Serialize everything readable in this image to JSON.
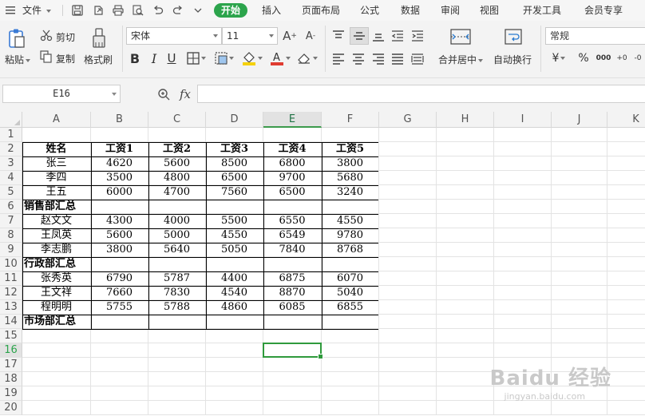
{
  "menubar": {
    "file_label": "文件",
    "tabs": [
      {
        "label": "开始",
        "active": true
      },
      {
        "label": "插入"
      },
      {
        "label": "页面布局"
      },
      {
        "label": "公式"
      },
      {
        "label": "数据"
      },
      {
        "label": "审阅"
      },
      {
        "label": "视图"
      },
      {
        "label": "开发工具"
      },
      {
        "label": "会员专享"
      }
    ]
  },
  "ribbon": {
    "paste_label": "粘贴",
    "cut_label": "剪切",
    "copy_label": "复制",
    "format_painter_label": "格式刷",
    "font_name": "宋体",
    "font_size": "11",
    "bold_glyph": "B",
    "italic_glyph": "I",
    "underline_glyph": "U",
    "merge_label": "合并居中",
    "wrap_label": "自动换行",
    "number_format": "常规",
    "currency_glyph": "¥",
    "percent_glyph": "%",
    "thousands_glyph": "000",
    "increase_decimal_glyph": "+0",
    "decrease_decimal_glyph": "-0",
    "accent_color": "#2ca44c",
    "font_color": "#e03c31",
    "fill_color": "#f5d10b"
  },
  "formula_bar": {
    "name_box": "E16",
    "fx_label": "fx",
    "formula": ""
  },
  "grid": {
    "columns": [
      "A",
      "B",
      "C",
      "D",
      "E",
      "F",
      "G",
      "H",
      "I",
      "J",
      "K"
    ],
    "rows": [
      "1",
      "2",
      "3",
      "4",
      "5",
      "6",
      "7",
      "8",
      "9",
      "10",
      "11",
      "12",
      "13",
      "14",
      "15",
      "16",
      "17",
      "18",
      "19",
      "20"
    ],
    "active_cell": "E16",
    "header": [
      "姓名",
      "工资1",
      "工资2",
      "工资3",
      "工资4",
      "工资5"
    ],
    "data_rows": [
      [
        "张三",
        "4620",
        "5600",
        "8500",
        "6800",
        "3800"
      ],
      [
        "李四",
        "3500",
        "4800",
        "6500",
        "9700",
        "5680"
      ],
      [
        "王五",
        "6000",
        "4700",
        "7560",
        "6500",
        "3240"
      ],
      [
        "销售部汇总",
        "",
        "",
        "",
        "",
        ""
      ],
      [
        "赵文文",
        "4300",
        "4000",
        "5500",
        "6550",
        "4550"
      ],
      [
        "王凤英",
        "5600",
        "5000",
        "4550",
        "6549",
        "9780"
      ],
      [
        "李志鹏",
        "3800",
        "5640",
        "5050",
        "7840",
        "8768"
      ],
      [
        "行政部汇总",
        "",
        "",
        "",
        "",
        ""
      ],
      [
        "张秀英",
        "6790",
        "5787",
        "4400",
        "6875",
        "6070"
      ],
      [
        "王文祥",
        "7660",
        "7830",
        "4540",
        "8870",
        "5040"
      ],
      [
        "程明明",
        "5755",
        "5788",
        "4860",
        "6085",
        "6855"
      ],
      [
        "市场部汇总",
        "",
        "",
        "",
        "",
        ""
      ]
    ]
  },
  "watermark": {
    "brand": "Baidu 经验",
    "url": "jingyan.baidu.com"
  }
}
